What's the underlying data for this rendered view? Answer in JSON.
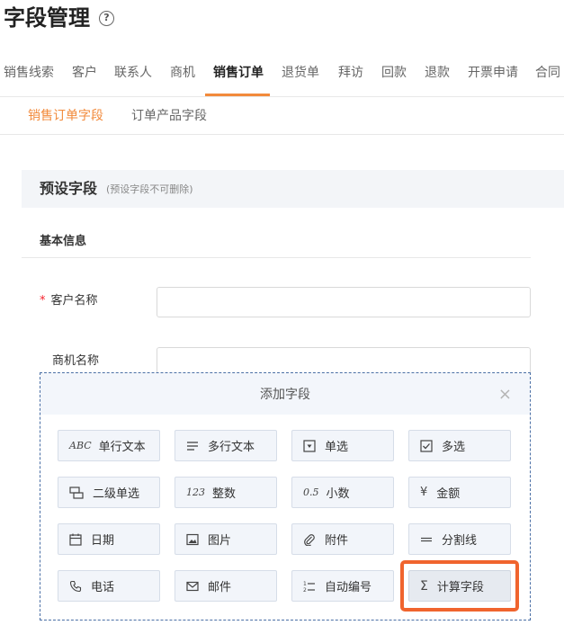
{
  "page": {
    "title": "字段管理",
    "help_icon": "?"
  },
  "tabs": [
    {
      "label": "销售线索"
    },
    {
      "label": "客户"
    },
    {
      "label": "联系人"
    },
    {
      "label": "商机"
    },
    {
      "label": "销售订单",
      "active": true
    },
    {
      "label": "退货单"
    },
    {
      "label": "拜访"
    },
    {
      "label": "回款"
    },
    {
      "label": "退款"
    },
    {
      "label": "开票申请"
    },
    {
      "label": "合同"
    }
  ],
  "subtabs": [
    {
      "label": "销售订单字段",
      "active": true
    },
    {
      "label": "订单产品字段"
    }
  ],
  "section": {
    "title": "预设字段",
    "note": "(预设字段不可删除)"
  },
  "group": {
    "title": "基本信息"
  },
  "fields": [
    {
      "label": "客户名称",
      "required": true,
      "required_mark": "*"
    },
    {
      "label": "商机名称",
      "required": false
    }
  ],
  "add_panel": {
    "title": "添加字段",
    "close": "×",
    "buttons": [
      {
        "label": "单行文本",
        "icon": "abc-text-icon",
        "icon_text": "ABC"
      },
      {
        "label": "多行文本",
        "icon": "multiline-icon"
      },
      {
        "label": "单选",
        "icon": "dropdown-icon"
      },
      {
        "label": "多选",
        "icon": "checkbox-icon"
      },
      {
        "label": "二级单选",
        "icon": "cascade-select-icon"
      },
      {
        "label": "整数",
        "icon": "integer-icon",
        "icon_text": "123"
      },
      {
        "label": "小数",
        "icon": "decimal-icon",
        "icon_text": "0.5"
      },
      {
        "label": "金额",
        "icon": "yen-icon",
        "icon_text": "¥"
      },
      {
        "label": "日期",
        "icon": "calendar-icon"
      },
      {
        "label": "图片",
        "icon": "image-icon"
      },
      {
        "label": "附件",
        "icon": "paperclip-icon"
      },
      {
        "label": "分割线",
        "icon": "divider-icon"
      },
      {
        "label": "电话",
        "icon": "phone-icon"
      },
      {
        "label": "邮件",
        "icon": "mail-icon"
      },
      {
        "label": "自动编号",
        "icon": "numbered-list-icon"
      },
      {
        "label": "计算字段",
        "icon": "sigma-icon",
        "icon_text": "Σ",
        "selected": true
      }
    ]
  },
  "colors": {
    "accent": "#f28a3b",
    "highlight": "#f0642e",
    "required": "#f5222d"
  }
}
